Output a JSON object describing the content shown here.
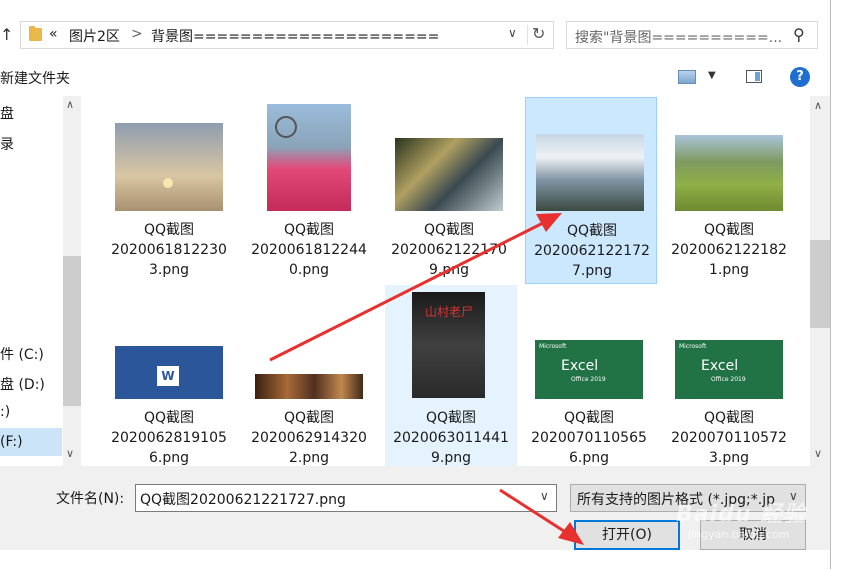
{
  "address_bar": {
    "chevrons": "«",
    "crumb1": "图片2区",
    "sep": ">",
    "crumb2": "背景图====================="
  },
  "search": {
    "placeholder": "搜索\"背景图==========..."
  },
  "toolbar": {
    "new_folder": "新建文件夹"
  },
  "nav": {
    "items": [
      {
        "label": "盘"
      },
      {
        "label": "录"
      },
      {
        "label": "件 (C:)"
      },
      {
        "label": "盘 (D:)"
      },
      {
        "label": ":)"
      },
      {
        "label": "(F:)"
      }
    ]
  },
  "files": [
    {
      "name1": "QQ截图",
      "name2": "2020061812230",
      "name3": "3.png",
      "colors": [
        "#c9b79a",
        "#7f8fa0"
      ]
    },
    {
      "name1": "QQ截图",
      "name2": "2020061812244",
      "name3": "0.png",
      "colors": [
        "#e24a7a",
        "#7aa0c8"
      ]
    },
    {
      "name1": "QQ截图",
      "name2": "2020062122170",
      "name3": "9.png",
      "colors": [
        "#3b4a2e",
        "#9fb0b8"
      ]
    },
    {
      "name1": "QQ截图",
      "name2": "2020062122172",
      "name3": "7.png",
      "colors": [
        "#b8c8d4",
        "#4f6270"
      ]
    },
    {
      "name1": "QQ截图",
      "name2": "2020062122182",
      "name3": "1.png",
      "colors": [
        "#6d9b3a",
        "#a8c0d8"
      ]
    },
    {
      "name1": "QQ截图",
      "name2": "2020062819105",
      "name3": "6.png",
      "colors": [
        "#2b579a",
        "#2b579a"
      ]
    },
    {
      "name1": "QQ截图",
      "name2": "2020062914320",
      "name3": "2.png",
      "colors": [
        "#6b3a20",
        "#b07040"
      ]
    },
    {
      "name1": "QQ截图",
      "name2": "2020063011441",
      "name3": "9.png",
      "colors": [
        "#2a2a2a",
        "#555555"
      ]
    },
    {
      "name1": "QQ截图",
      "name2": "2020070110565",
      "name3": "6.png",
      "colors": [
        "#217346",
        "#217346"
      ]
    },
    {
      "name1": "QQ截图",
      "name2": "2020070110572",
      "name3": "3.png",
      "colors": [
        "#217346",
        "#217346"
      ]
    }
  ],
  "filename": {
    "label": "文件名(N):",
    "value": "QQ截图20200621221727.png"
  },
  "filetype": {
    "value": "所有支持的图片格式 (*.jpg;*.jp"
  },
  "buttons": {
    "open": "打开(O)",
    "cancel": "取消"
  },
  "thumb_text": {
    "excel": "Excel",
    "office": "Office 2019",
    "ms": "Microsoft",
    "poster": "山村老尸"
  },
  "watermark": {
    "main": "Baidu 经验",
    "sub": "jingyan.baidu.com"
  },
  "colors": {
    "selection": "#cce8ff",
    "accent": "#0078d7",
    "arrow": "#e8312e"
  }
}
